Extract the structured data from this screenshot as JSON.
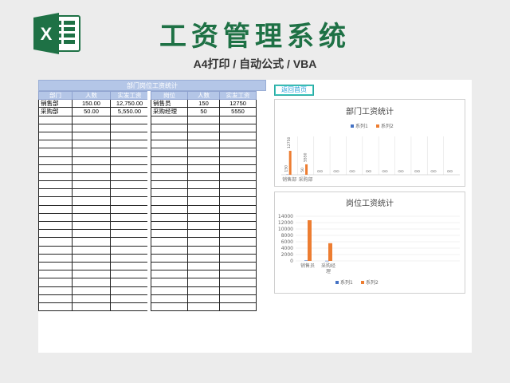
{
  "header": {
    "title": "工资管理系统",
    "subtitle": "A4打印 / 自动公式 / VBA",
    "logo_letter": "X"
  },
  "colors": {
    "accent_green": "#1e7145",
    "header_blue": "#b4c6e7",
    "series1": "#4472c4",
    "series2": "#ed7d31",
    "button_teal": "#3ec8c0"
  },
  "table": {
    "title": "部门岗位工资统计",
    "dept_headers": [
      "部门",
      "人数",
      "实发工资"
    ],
    "dept_rows": [
      [
        "销售部",
        "150.00",
        "12,750.00"
      ],
      [
        "采购部",
        "50.00",
        "5,550.00"
      ]
    ],
    "pos_headers": [
      "岗位",
      "人数",
      "实发工资"
    ],
    "pos_rows": [
      [
        "销售员",
        "150",
        "12750"
      ],
      [
        "采购经理",
        "50",
        "5550"
      ]
    ],
    "empty_rows": 24
  },
  "back_button": {
    "label": "返回首页"
  },
  "chart_data": [
    {
      "type": "bar",
      "title": "部门工资统计",
      "categories": [
        "销售部",
        "采购部",
        "",
        "",
        "",
        "",
        "",
        "",
        "",
        "",
        ""
      ],
      "series": [
        {
          "name": "系列1",
          "values": [
            150,
            50,
            0,
            0,
            0,
            0,
            0,
            0,
            0,
            0,
            0
          ]
        },
        {
          "name": "系列2",
          "values": [
            12750,
            5550,
            0,
            0,
            0,
            0,
            0,
            0,
            0,
            0,
            0
          ]
        }
      ],
      "data_labels": [
        "150",
        "12750",
        "50",
        "5550",
        "0",
        "0",
        "0",
        "0",
        "0",
        "0",
        "0",
        "0",
        "0",
        "0",
        "0",
        "0",
        "0",
        "0",
        "0",
        "0",
        "0",
        "0"
      ],
      "legend": "top",
      "grid": true
    },
    {
      "type": "bar",
      "title": "岗位工资统计",
      "categories": [
        "销售员",
        "采购经理"
      ],
      "series": [
        {
          "name": "系列1",
          "values": [
            150,
            50
          ]
        },
        {
          "name": "系列2",
          "values": [
            12750,
            5550
          ]
        }
      ],
      "yticks": [
        "14000",
        "12000",
        "10000",
        "8000",
        "6000",
        "4000",
        "2000",
        "0"
      ],
      "ylim": [
        0,
        14000
      ],
      "legend": "bottom",
      "grid": true
    }
  ]
}
